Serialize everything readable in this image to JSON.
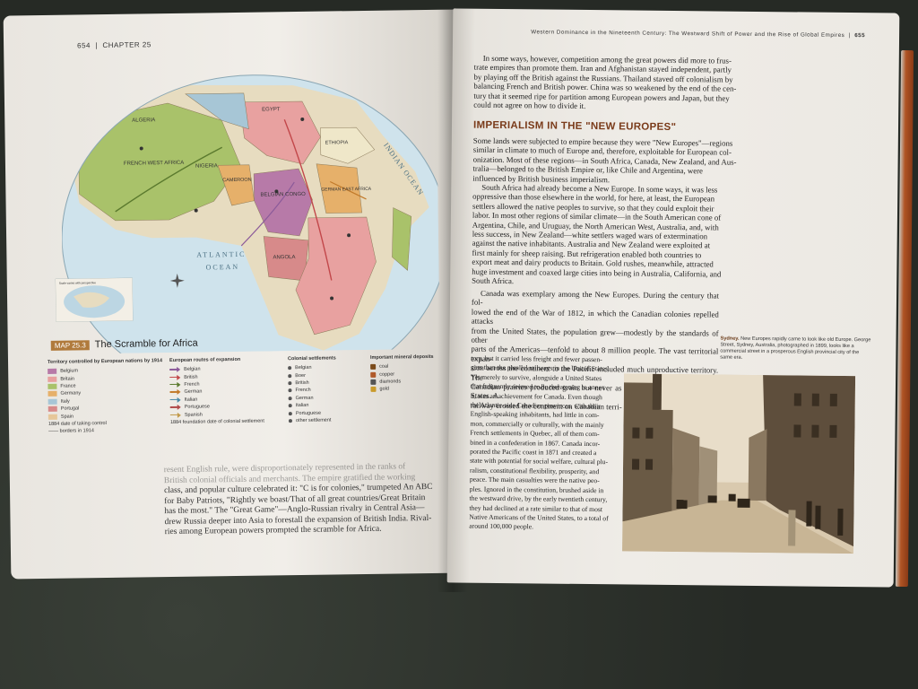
{
  "left_page": {
    "page_number": "654",
    "chapter_label": "CHAPTER 25",
    "map": {
      "tag": "MAP 25.3",
      "title": "The Scramble for Africa",
      "ocean_labels": [
        "ATLANTIC",
        "OCEAN",
        "INDIAN OCEAN"
      ],
      "region_labels": [
        "ALGERIA",
        "EGYPT",
        "FRENCH WEST AFRICA",
        "NIGERIA",
        "CAMEROON",
        "BELGIAN CONGO",
        "ANGOLA",
        "ETHIOPIA",
        "GERMAN EAST AFRICA"
      ],
      "inset_label": "Scale varies with perspective",
      "legend": {
        "territory": {
          "heading": "Territory controlled by European nations by 1914",
          "items": [
            {
              "label": "Belgium",
              "color": "#b77aa8"
            },
            {
              "label": "Britain",
              "color": "#e8a1a0"
            },
            {
              "label": "France",
              "color": "#a9c26a"
            },
            {
              "label": "Germany",
              "color": "#e6b06a"
            },
            {
              "label": "Italy",
              "color": "#a7c6d6"
            },
            {
              "label": "Portugal",
              "color": "#d78a8a"
            },
            {
              "label": "Spain",
              "color": "#e6c79a"
            }
          ],
          "notes": [
            "1884  date of taking control",
            "—— borders in 1914"
          ]
        },
        "routes": {
          "heading": "European routes of expansion",
          "items": [
            {
              "label": "Belgian",
              "color": "#8b5a9a"
            },
            {
              "label": "British",
              "color": "#c2474a"
            },
            {
              "label": "French",
              "color": "#5b7a2e"
            },
            {
              "label": "German",
              "color": "#c27a2a"
            },
            {
              "label": "Italian",
              "color": "#4a8aa8"
            },
            {
              "label": "Portuguese",
              "color": "#b04a4a"
            },
            {
              "label": "Spanish",
              "color": "#c29a4a"
            }
          ],
          "note": "1884  foundation date of colonial settlement"
        },
        "settlements": {
          "heading": "Colonial settlements",
          "items": [
            "Belgian",
            "Boer",
            "British",
            "French",
            "German",
            "Italian",
            "Portuguese",
            "other settlement"
          ]
        },
        "minerals": {
          "heading": "Important mineral deposits",
          "items": [
            "coal",
            "copper",
            "diamonds",
            "gold"
          ]
        }
      }
    },
    "text_lines": [
      "resent English rule, were disproportionately represented in the ranks of",
      "British colonial officials and merchants. The empire gratified the working",
      "class, and popular culture celebrated it: \"C is for colonies,\" trumpeted An ABC",
      "for Baby Patriots, \"Rightly we boast/That of all great countries/Great Britain",
      "has the most.\" The \"Great Game\"—Anglo-Russian rivalry in Central Asia—",
      "drew Russia deeper into Asia to forestall the expansion of British India. Rival-",
      "ries among European powers prompted the scramble for Africa."
    ]
  },
  "right_page": {
    "running_head": "Western Dominance in the Nineteenth Century: The Westward Shift of Power and the Rise of Global Empires",
    "page_number": "655",
    "intro_lines": [
      "In some ways, however, competition among the great powers did more to frus-",
      "trate empires than promote them. Iran and Afghanistan stayed independent, partly",
      "by playing off the British against the Russians. Thailand staved off colonialism by",
      "balancing French and British power. China was so weakened by the end of the cen-",
      "tury that it seemed ripe for partition among European powers and Japan, but they",
      "could not agree on how to divide it."
    ],
    "heading": "IMPERIALISM IN THE \"NEW EUROPES\"",
    "body_lines": [
      "Some lands were subjected to empire because they were \"New Europes\"—regions",
      "similar in climate to much of Europe and, therefore, exploitable for European col-",
      "onization. Most of these regions—in South Africa, Canada, New Zealand, and Aus-",
      "tralia—belonged to the British Empire or, like Chile and Argentina, were",
      "influenced by British business imperialism.",
      "South Africa had already become a New Europe. In some ways, it was less",
      "oppressive than those elsewhere in the world, for here, at least, the European",
      "settlers allowed the native peoples to survive, so that they could exploit their",
      "labor. In most other regions of similar climate—in the South American cone of",
      "Argentina, Chile, and Uruguay, the North American West, Australia, and, with",
      "less success, in New Zealand—white settlers waged wars of extermination",
      "against the native inhabitants. Australia and New Zealand were exploited at",
      "first mainly for sheep raising. But refrigeration enabled both countries to",
      "export meat and dairy products to Britain. Gold rushes, meanwhile, attracted",
      "huge investment and coaxed large cities into being in Australia, California, and",
      "South Africa."
    ],
    "canada_lines_full": [
      "Canada was exemplary among the New Europes. During the century that fol-",
      "lowed the end of the War of 1812, in which the Canadian colonies repelled attacks",
      "from the United States, the population grew—modestly by the standards of other",
      "parts of the Americas—tenfold to about 8 million people. The vast territorial expan-",
      "sion across the continent to the Pacific included much unproductive territory. The",
      "Canadian prairies produced grain but never as much as those of the United States. A",
      "railway crossed the continent on Canadian terri-"
    ],
    "canada_lines_narrow": [
      "tory, but it carried less freight and fewer passen-",
      "gers than the parallel railways in the United States.",
      "Yet merely to survive, alongside a United States",
      "that frequently seemed to be threatening to annex",
      "it, was an achievement for Canada. Even though",
      "the Atlantic-side Canadian provinces, with their",
      "English-speaking inhabitants, had little in com-",
      "mon, commercially or culturally, with the mainly",
      "French settlements in Quebec, all of them com-",
      "bined in a confederation in 1867. Canada incor-",
      "porated the Pacific coast in 1871 and created a",
      "state with potential for social welfare, cultural plu-",
      "ralism, constitutional flexibility, prosperity, and",
      "peace. The main casualties were the native peo-",
      "ples. Ignored in the constitution, brushed aside in",
      "the westward drive, by the early twentieth century,",
      "they had declined at a rate similar to that of most",
      "Native Americans of the United States, to a total of",
      "around 100,000 people."
    ],
    "caption_bold": "Sydney.",
    "caption_text": "New Europes rapidly came to look like old Europe. George Street, Sydney, Australia, photographed in 1899, looks like a commercial street in a prosperous English provincial city of the same era."
  }
}
